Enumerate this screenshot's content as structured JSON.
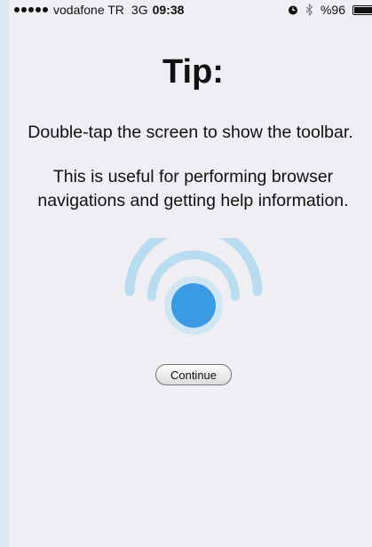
{
  "status_bar": {
    "carrier": "vodafone TR",
    "network": "3G",
    "time": "09:38",
    "battery": "%96",
    "battery_level": 0.96
  },
  "tip": {
    "title": "Tip:",
    "line1": "Double-tap the screen to show the toolbar.",
    "line2": "This is useful for performing browser navigations and getting help information."
  },
  "continue_label": "Continue",
  "colors": {
    "background": "#eeeef3",
    "dot": "#3a9be3",
    "rings": "#b9dcf1"
  },
  "icons": [
    "alarm-icon",
    "bluetooth-icon",
    "battery-icon",
    "double-tap-icon"
  ]
}
